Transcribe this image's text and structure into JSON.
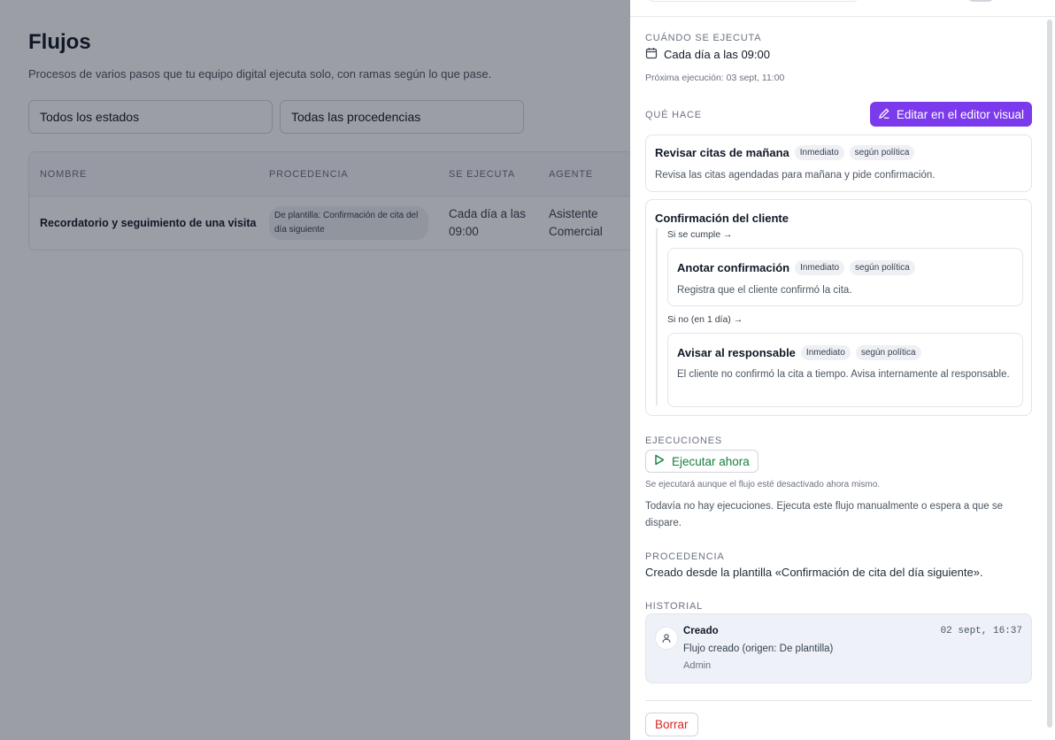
{
  "page": {
    "title": "Flujos",
    "subtitle": "Procesos de varios pasos que tu equipo digital ejecuta solo, con ramas según lo que pase.",
    "filters": {
      "status": "Todos los estados",
      "origin": "Todas las procedencias"
    },
    "table": {
      "headers": [
        "NOMBRE",
        "PROCEDENCIA",
        "SE EJECUTA",
        "AGENTE"
      ],
      "rows": [
        {
          "name": "Recordatorio y seguimiento de una visita",
          "origin": "De plantilla: Confirmación de cita del día siguiente",
          "schedule": "Cada día a las 09:00",
          "agent": "Asistente Comercial"
        }
      ]
    }
  },
  "drawer": {
    "when": {
      "label": "CUÁNDO SE EJECUTA",
      "schedule": "Cada día a las 09:00",
      "next_run": "Próxima ejecución: 03 sept, 11:00"
    },
    "what": {
      "label": "QUÉ HACE",
      "edit_button": "Editar en el editor visual",
      "steps": [
        {
          "title": "Revisar citas de mañana",
          "badges": [
            "Inmediato",
            "según política"
          ],
          "description": "Revisa las citas agendadas para mañana y pide confirmación."
        }
      ],
      "condition": {
        "title": "Confirmación del cliente",
        "yes_label": "Si se cumple →",
        "yes_step": {
          "title": "Anotar confirmación",
          "badges": [
            "Inmediato",
            "según política"
          ],
          "description": "Registra que el cliente confirmó la cita."
        },
        "no_label": "Si no (en 1 día) →",
        "no_step": {
          "title": "Avisar al responsable",
          "badges": [
            "Inmediato",
            "según política"
          ],
          "description": "El cliente no confirmó la cita a tiempo. Avisa internamente al responsable."
        }
      }
    },
    "runs": {
      "label": "EJECUCIONES",
      "run_button": "Ejecutar ahora",
      "run_note": "Se ejecutará aunque el flujo esté desactivado ahora mismo.",
      "empty": "Todavía no hay ejecuciones. Ejecuta este flujo manualmente o espera a que se dispare."
    },
    "origin": {
      "label": "PROCEDENCIA",
      "text": "Creado desde la plantilla «Confirmación de cita del día siguiente»."
    },
    "history": {
      "label": "HISTORIAL",
      "entries": [
        {
          "title": "Creado",
          "time": "02 sept, 16:37",
          "description": "Flujo creado (origen: De plantilla)",
          "user": "Admin"
        }
      ]
    },
    "delete_button": "Borrar"
  },
  "colors": {
    "accent": "#7c3aed",
    "run_green": "#15803d",
    "danger": "#dc2626"
  }
}
